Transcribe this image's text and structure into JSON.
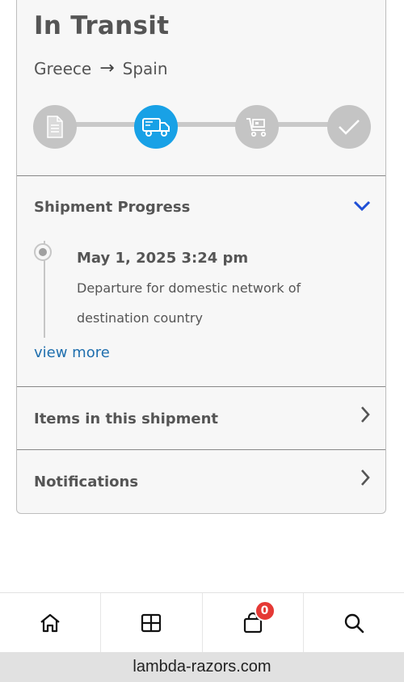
{
  "shipment": {
    "status": "In Transit",
    "origin": "Greece",
    "destination": "Spain",
    "arrow": "→",
    "current_step": 2,
    "steps": [
      {
        "icon": "document-icon",
        "state": "complete"
      },
      {
        "icon": "truck-icon",
        "state": "active"
      },
      {
        "icon": "cart-icon",
        "state": "pending"
      },
      {
        "icon": "checkmark-icon",
        "state": "pending"
      }
    ]
  },
  "progress": {
    "title": "Shipment Progress",
    "expanded": true,
    "event": {
      "date": "May 1, 2025 3:24 pm",
      "description": "Departure for domestic network of destination country"
    },
    "view_more": "view more"
  },
  "items": {
    "title": "Items in this shipment"
  },
  "notifications": {
    "title": "Notifications"
  },
  "nav": {
    "items": [
      {
        "icon": "home-icon"
      },
      {
        "icon": "grid-icon"
      },
      {
        "icon": "shopping-bag-icon",
        "badge": "0"
      },
      {
        "icon": "search-icon"
      }
    ]
  },
  "browser": {
    "url": "lambda-razors.com"
  },
  "colors": {
    "accent": "#18a1e6",
    "link": "#1f6fae",
    "chevron_active": "#1f4fd6",
    "badge": "#e53935",
    "step_inactive": "#c4c4c4"
  }
}
